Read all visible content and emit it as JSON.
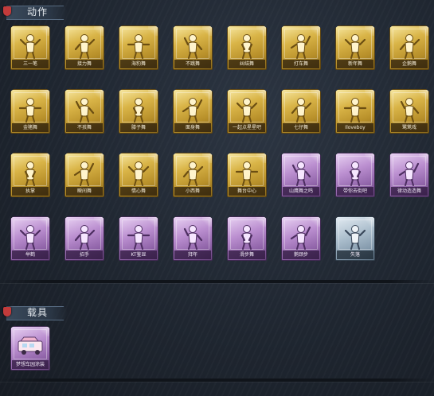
{
  "sections": {
    "actions_title": "动作",
    "tools_title": "载具"
  },
  "actions": [
    {
      "label": "三一笔",
      "rarity": "gold"
    },
    {
      "label": "接力舞",
      "rarity": "gold"
    },
    {
      "label": "海豹舞",
      "rarity": "gold"
    },
    {
      "label": "不跳舞",
      "rarity": "gold"
    },
    {
      "label": "纠结舞",
      "rarity": "gold"
    },
    {
      "label": "打车舞",
      "rarity": "gold"
    },
    {
      "label": "新年舞",
      "rarity": "gold"
    },
    {
      "label": "企鹅舞",
      "rarity": "gold"
    },
    {
      "label": "金猪舞",
      "rarity": "gold"
    },
    {
      "label": "不孩舞",
      "rarity": "gold"
    },
    {
      "label": "膝子舞",
      "rarity": "gold"
    },
    {
      "label": "面身舞",
      "rarity": "gold"
    },
    {
      "label": "一起点星星吧",
      "rarity": "gold"
    },
    {
      "label": "七仔舞",
      "rarity": "gold"
    },
    {
      "label": "Iloveboy",
      "rarity": "gold"
    },
    {
      "label": "鹭鸶戏",
      "rarity": "gold"
    },
    {
      "label": "执掌",
      "rarity": "gold"
    },
    {
      "label": "瞬间舞",
      "rarity": "gold"
    },
    {
      "label": "情心舞",
      "rarity": "gold"
    },
    {
      "label": "小西舞",
      "rarity": "gold"
    },
    {
      "label": "舞台中心",
      "rarity": "gold"
    },
    {
      "label": "山鹰舞之鸣",
      "rarity": "purple"
    },
    {
      "label": "带你去街吧",
      "rarity": "purple"
    },
    {
      "label": "律动造造舞",
      "rarity": "purple"
    },
    {
      "label": "举鹤",
      "rarity": "purple"
    },
    {
      "label": "招手",
      "rarity": "purple"
    },
    {
      "label": "KT鉴显",
      "rarity": "purple"
    },
    {
      "label": "拜年",
      "rarity": "purple"
    },
    {
      "label": "滑步舞",
      "rarity": "purple"
    },
    {
      "label": "鹅颈步",
      "rarity": "purple"
    },
    {
      "label": "失落",
      "rarity": "blue"
    }
  ],
  "vehicles": [
    {
      "label": "梦想车园涂装",
      "rarity": "purple"
    }
  ],
  "colors": {
    "gold": "#d9b447",
    "purple": "#bb8fd0",
    "blue": "#a9bccb",
    "background": "#1e252f"
  }
}
